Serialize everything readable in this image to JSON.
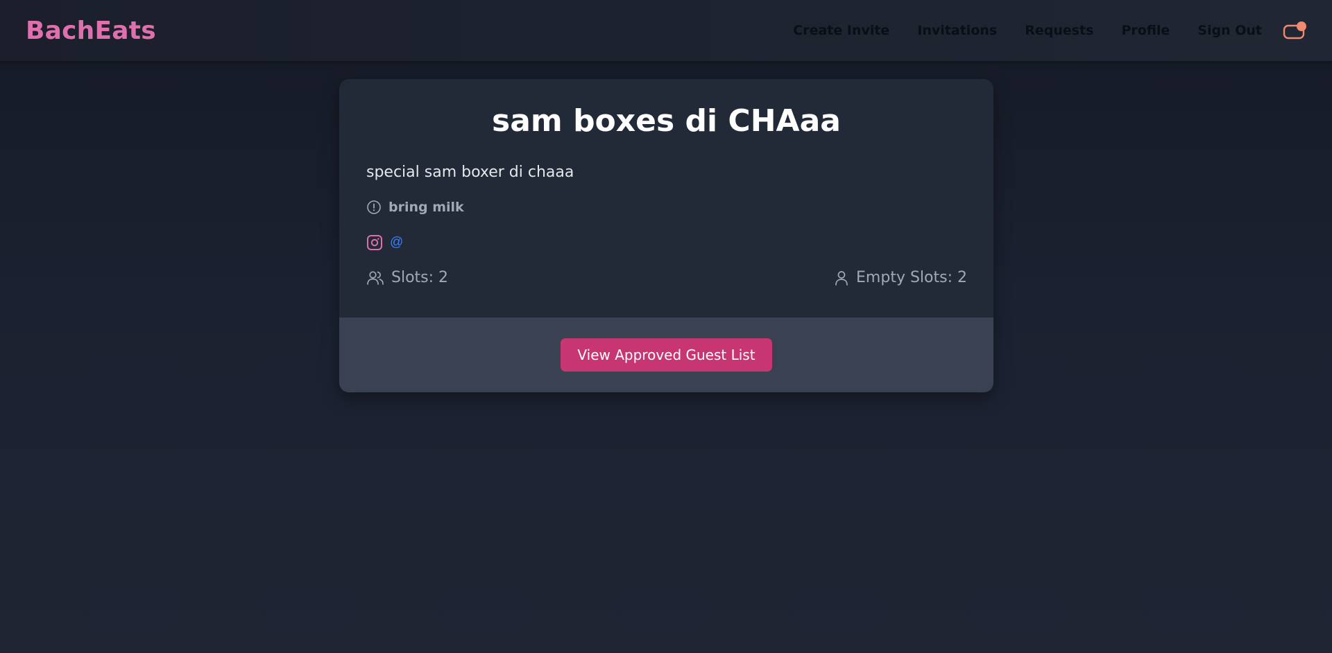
{
  "app": {
    "brand": "BachEats"
  },
  "nav": {
    "links": [
      "Create Invite",
      "Invitations",
      "Requests",
      "Profile",
      "Sign Out"
    ],
    "cart_icon": "cart-icon",
    "badge_color": "#f08a6e"
  },
  "invite": {
    "title": "sam boxes di CHAaa",
    "description": "special sam boxer di chaaa",
    "note": "bring milk",
    "instagram_handle": "@",
    "slots": "Slots: 2",
    "empty_slots": "Empty Slots: 2"
  },
  "actions": {
    "view_guest_list": "View Approved Guest List"
  },
  "colors": {
    "brand": "#e070ad",
    "primary_button": "#c83573",
    "link": "#3b82f6"
  }
}
